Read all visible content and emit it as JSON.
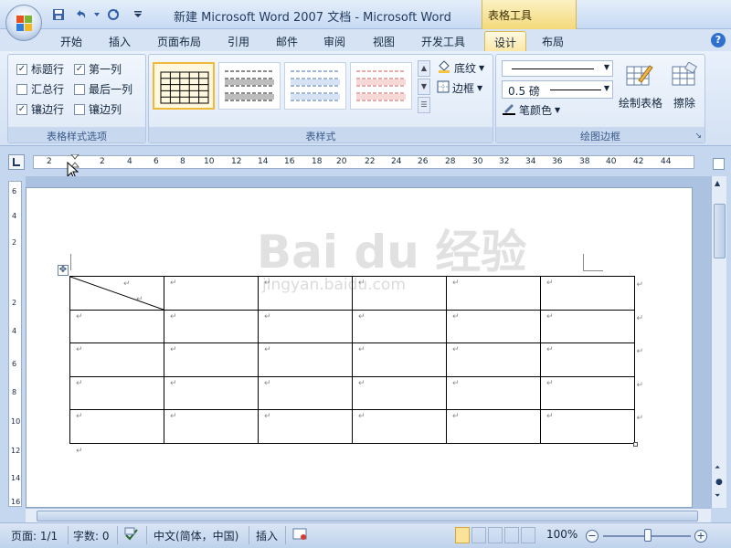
{
  "window": {
    "title": "新建 Microsoft Word 2007 文档 - Microsoft Word",
    "context_title": "表格工具"
  },
  "tabs": [
    {
      "label": "开始"
    },
    {
      "label": "插入"
    },
    {
      "label": "页面布局"
    },
    {
      "label": "引用"
    },
    {
      "label": "邮件"
    },
    {
      "label": "审阅"
    },
    {
      "label": "视图"
    },
    {
      "label": "开发工具"
    },
    {
      "label": "设计",
      "active": true
    },
    {
      "label": "布局"
    }
  ],
  "ribbon": {
    "options": {
      "items": [
        {
          "label": "标题行",
          "checked": true
        },
        {
          "label": "第一列",
          "checked": true
        },
        {
          "label": "汇总行",
          "checked": false
        },
        {
          "label": "最后一列",
          "checked": false
        },
        {
          "label": "镶边行",
          "checked": true
        },
        {
          "label": "镶边列",
          "checked": false
        }
      ],
      "group_label": "表格样式选项"
    },
    "styles": {
      "shading_label": "底纹",
      "borders_label": "边框",
      "group_label": "表样式"
    },
    "draw": {
      "line_weight": "0.5 磅",
      "pen_color_label": "笔颜色",
      "draw_table_label": "绘制表格",
      "eraser_label": "擦除",
      "group_label": "绘图边框"
    }
  },
  "ruler": {
    "ticks": [
      "2",
      "2",
      "4",
      "6",
      "8",
      "10",
      "12",
      "14",
      "16",
      "18",
      "20",
      "22",
      "24",
      "26",
      "28",
      "30",
      "32",
      "34",
      "36",
      "38",
      "40",
      "42",
      "44"
    ]
  },
  "vruler": {
    "ticks": [
      "6",
      "4",
      "2",
      "2",
      "4",
      "6",
      "8",
      "10",
      "12",
      "14",
      "16"
    ]
  },
  "document": {
    "watermark": "Bai du 经验",
    "watermark_sub": "jingyan.baidu.com",
    "paragraph_mark": "↵",
    "table_rows": 5,
    "table_cols": 6
  },
  "status": {
    "page": "页面: 1/1",
    "words": "字数: 0",
    "language": "中文(简体，中国)",
    "mode": "插入",
    "zoom": "100%"
  },
  "colors": {
    "ribbon_bg": "#dce8f6",
    "active_tab": "#fbe7a6",
    "context_tab": "#f4d97a"
  }
}
